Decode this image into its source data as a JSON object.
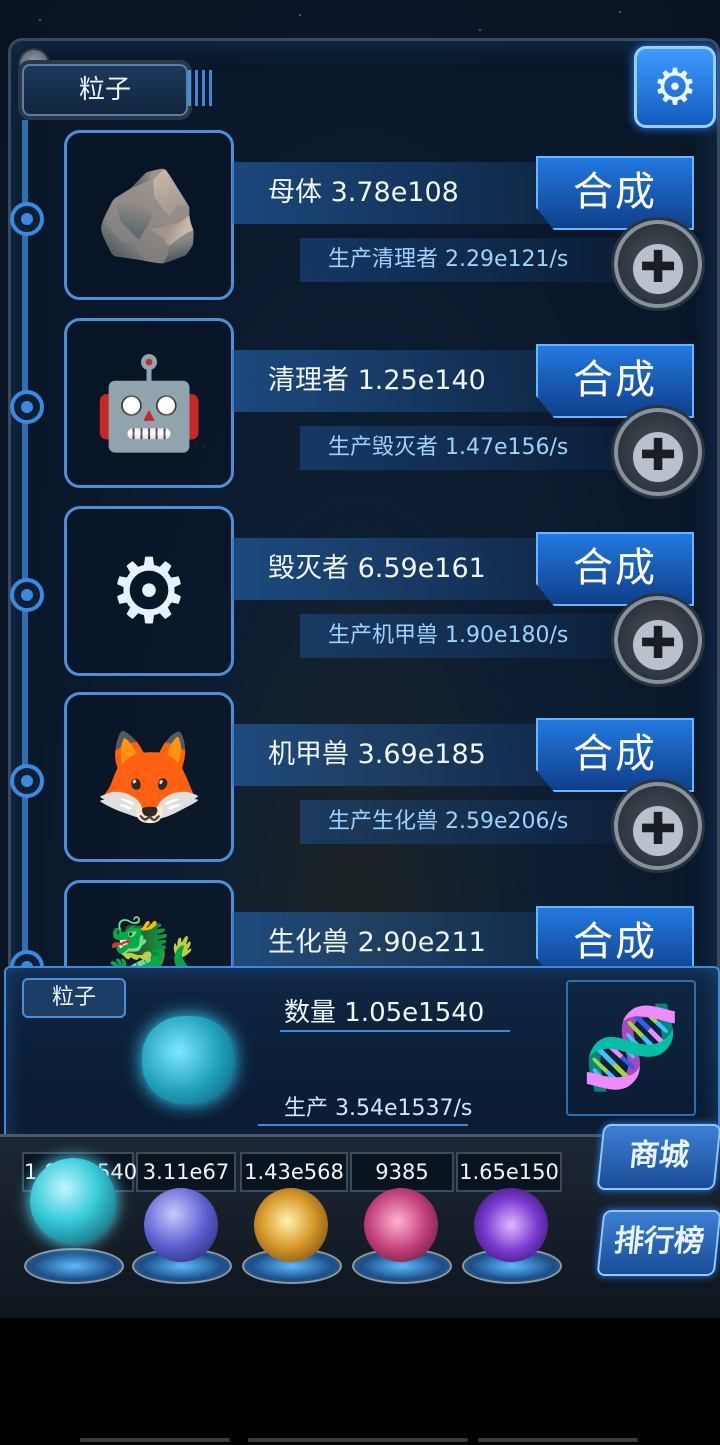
{
  "header": {
    "tab_label": "粒子",
    "settings_icon": "gear-icon"
  },
  "units": [
    {
      "name_line": "母体 3.78e108",
      "produce_line": "生产清理者 2.29e121/s",
      "merge_label": "合成",
      "portrait_icon": "mother-creature-icon",
      "glyph": "🪨"
    },
    {
      "name_line": "清理者 1.25e140",
      "produce_line": "生产毁灭者 1.47e156/s",
      "merge_label": "合成",
      "portrait_icon": "cleaner-robot-icon",
      "glyph": "🤖"
    },
    {
      "name_line": "毁灭者 6.59e161",
      "produce_line": "生产机甲兽 1.90e180/s",
      "merge_label": "合成",
      "portrait_icon": "destroyer-mech-icon",
      "glyph": "⚙"
    },
    {
      "name_line": "机甲兽 3.69e185",
      "produce_line": "生产生化兽 2.59e206/s",
      "merge_label": "合成",
      "portrait_icon": "mecha-beast-icon",
      "glyph": "🦊"
    },
    {
      "name_line": "生化兽 2.90e211",
      "merge_label": "合成",
      "portrait_icon": "bio-beast-icon",
      "glyph": "🐉"
    }
  ],
  "summary": {
    "label": "粒子",
    "count_line": "数量 1.05e1540",
    "produce_line": "生产 3.54e1537/s",
    "particle_icon": "particle-cluster-icon",
    "dna_icon": "dna-icon"
  },
  "resources": [
    {
      "value": "1.05e1540",
      "icon": "particle-orb-icon",
      "color": "#35c9d8"
    },
    {
      "value": "3.11e67",
      "icon": "lightning-orb-icon",
      "color": "#5b5fd0"
    },
    {
      "value": "1.43e568",
      "icon": "fire-orb-icon",
      "color": "#d99a2b"
    },
    {
      "value": "9385",
      "icon": "brain-orb-icon",
      "color": "#c2407a"
    },
    {
      "value": "1.65e150",
      "icon": "vortex-orb-icon",
      "color": "#7a3ad0"
    }
  ],
  "side_buttons": {
    "shop": "商城",
    "ranking": "排行榜"
  }
}
